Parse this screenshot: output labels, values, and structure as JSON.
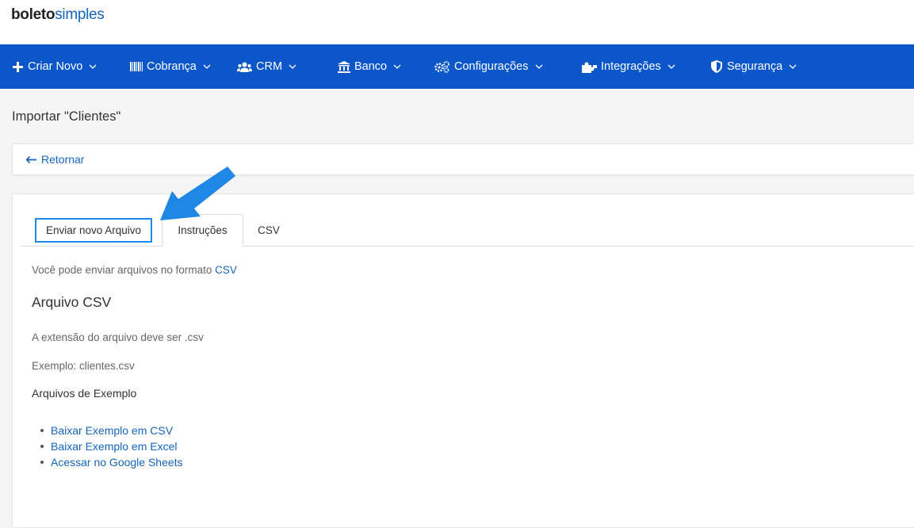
{
  "brand": {
    "logo_bold": "boleto",
    "logo_light": "simples"
  },
  "nav": {
    "items": [
      {
        "label": "Criar Novo",
        "icon": "plus-icon"
      },
      {
        "label": "Cobrança",
        "icon": "barcode-icon"
      },
      {
        "label": "CRM",
        "icon": "users-icon"
      },
      {
        "label": "Banco",
        "icon": "bank-icon"
      },
      {
        "label": "Configurações",
        "icon": "gears-icon"
      },
      {
        "label": "Integrações",
        "icon": "puzzle-icon"
      },
      {
        "label": "Segurança",
        "icon": "shield-icon"
      }
    ]
  },
  "page": {
    "title": "Importar \"Clientes\"",
    "back_label": "Retornar"
  },
  "tabs": {
    "items": [
      {
        "label": "Enviar novo Arquivo",
        "state": "highlighted"
      },
      {
        "label": "Instruções",
        "state": "active"
      },
      {
        "label": "CSV",
        "state": "inactive"
      }
    ]
  },
  "instructions": {
    "intro_text": "Você pode enviar arquivos no formato",
    "intro_link": "CSV",
    "csv_heading": "Arquivo CSV",
    "extension_text": "A extensão do arquivo deve ser .csv",
    "example_text": "Exemplo: clientes.csv",
    "examples_heading": "Arquivos de Exemplo",
    "example_links": [
      "Baixar Exemplo em CSV",
      "Baixar Exemplo em Excel",
      "Acessar no Google Sheets"
    ]
  },
  "colors": {
    "nav_bg": "#0b57c9",
    "link": "#1565c0",
    "highlight_border": "#1f88e5",
    "annotation_arrow": "#1f88e5"
  }
}
